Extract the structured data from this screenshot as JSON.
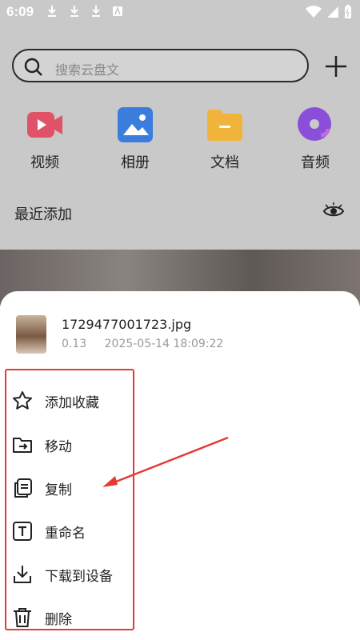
{
  "status_bar": {
    "time": "6:09"
  },
  "search": {
    "placeholder": "搜索云盘文"
  },
  "categories": [
    {
      "label": "视频",
      "icon": "video-icon",
      "color": "#e05267"
    },
    {
      "label": "相册",
      "icon": "photo-album-icon",
      "color": "#3b7ddd"
    },
    {
      "label": "文档",
      "icon": "folder-document-icon",
      "color": "#f0b43a"
    },
    {
      "label": "音频",
      "icon": "audio-disc-icon",
      "color": "#8a4fd8"
    }
  ],
  "recent": {
    "title": "最近添加"
  },
  "file": {
    "name": "1729477001723.jpg",
    "size": "0.13",
    "date": "2025-05-14 18:09:22"
  },
  "menu": {
    "items": [
      {
        "label": "添加收藏",
        "icon": "star-icon"
      },
      {
        "label": "移动",
        "icon": "move-folder-icon"
      },
      {
        "label": "复制",
        "icon": "copy-icon"
      },
      {
        "label": "重命名",
        "icon": "rename-icon"
      },
      {
        "label": "下载到设备",
        "icon": "download-icon"
      },
      {
        "label": "删除",
        "icon": "trash-icon"
      }
    ]
  },
  "colors": {
    "accent_red": "#e53935"
  }
}
